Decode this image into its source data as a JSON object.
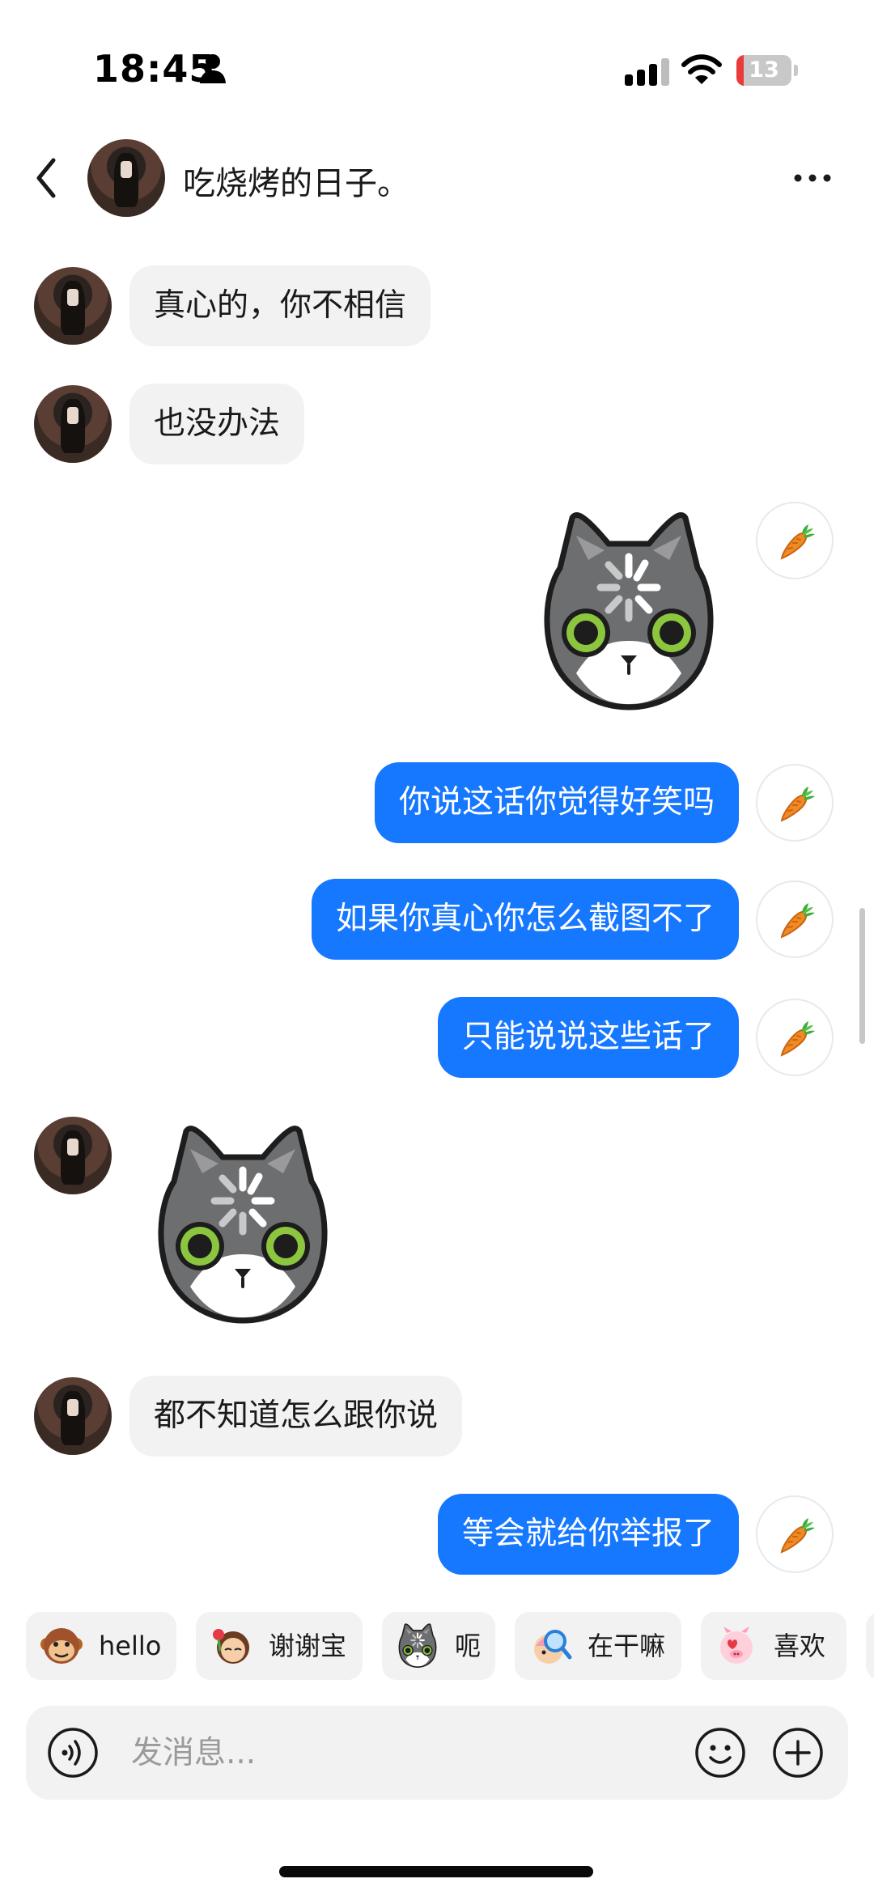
{
  "status_bar": {
    "time": "18:45",
    "battery": "13",
    "battery_level_percent": 13
  },
  "header": {
    "contact_name": "吃烧烤的日子。"
  },
  "messages": [
    {
      "side": "in",
      "type": "text",
      "text": "真心的，你不相信"
    },
    {
      "side": "in",
      "type": "text",
      "text": "也没办法"
    },
    {
      "side": "out",
      "type": "sticker",
      "sticker": "cat-loading-sticker"
    },
    {
      "side": "out",
      "type": "text",
      "text": "你说这话你觉得好笑吗"
    },
    {
      "side": "out",
      "type": "text",
      "text": "如果你真心你怎么截图不了"
    },
    {
      "side": "out",
      "type": "text",
      "text": "只能说说这些话了"
    },
    {
      "side": "in",
      "type": "sticker",
      "sticker": "cat-loading-sticker"
    },
    {
      "side": "in",
      "type": "text",
      "text": "都不知道怎么跟你说"
    },
    {
      "side": "out",
      "type": "text",
      "text": "等会就给你举报了"
    }
  ],
  "quick_replies": [
    {
      "label": "hello",
      "icon": "monkey-emoji-icon"
    },
    {
      "label": "谢谢宝",
      "icon": "girl-rose-emoji-icon"
    },
    {
      "label": "呃",
      "icon": "cat-emoji-icon"
    },
    {
      "label": "在干嘛",
      "icon": "magnifier-girl-emoji-icon"
    },
    {
      "label": "喜欢",
      "icon": "pig-heart-emoji-icon"
    }
  ],
  "input": {
    "placeholder": "发消息..."
  },
  "colors": {
    "outgoing_bubble": "#1677ff",
    "incoming_bubble": "#f2f2f2",
    "background": "#ffffff"
  }
}
